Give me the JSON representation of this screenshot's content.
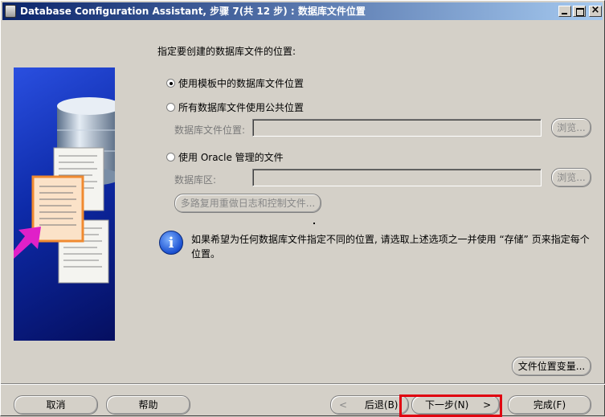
{
  "window": {
    "title": "Database Configuration Assistant, 步骤 7(共 12 步) : 数据库文件位置"
  },
  "main": {
    "heading": "指定要创建的数据库文件的位置:",
    "options": [
      {
        "label": "使用模板中的数据库文件位置",
        "selected": true
      },
      {
        "label": "所有数据库文件使用公共位置",
        "selected": false
      },
      {
        "label": "使用 Oracle 管理的文件",
        "selected": false
      }
    ],
    "common_location": {
      "label": "数据库文件位置:",
      "value": "",
      "browse_label": "浏览..."
    },
    "oracle_managed": {
      "label": "数据库区:",
      "value": "",
      "browse_label": "浏览..."
    },
    "multiplex_button": "多路复用重做日志和控制文件...",
    "info_text": "如果希望为任何数据库文件指定不同的位置, 请选取上述选项之一并使用 “存储” 页来指定每个位置。",
    "file_location_vars_button": "文件位置变量..."
  },
  "footer": {
    "cancel": "取消",
    "help": "帮助",
    "back": "后退(B)",
    "next": "下一步(N)",
    "finish": "完成(F)"
  },
  "colors": {
    "highlight": "#e00010",
    "titlebar": "#0a246a",
    "info_icon": "#1a4fd0"
  },
  "icons": {
    "info": "i"
  }
}
